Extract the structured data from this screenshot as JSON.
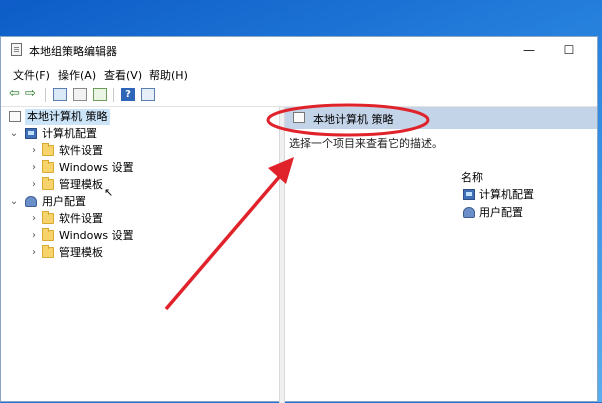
{
  "window": {
    "title": "本地组策略编辑器",
    "controls": {
      "minimize": "—",
      "maximize": "☐"
    }
  },
  "menu": [
    "文件(F)",
    "操作(A)",
    "查看(V)",
    "帮助(H)"
  ],
  "tree": {
    "root": "本地计算机 策略",
    "computer_config": "计算机配置",
    "computer_children": [
      "软件设置",
      "Windows 设置",
      "管理模板"
    ],
    "user_config": "用户配置",
    "user_children": [
      "软件设置",
      "Windows 设置",
      "管理模板"
    ]
  },
  "right": {
    "header": "本地计算机 策略",
    "description": "选择一个项目来查看它的描述。",
    "column_header": "名称",
    "items": [
      "计算机配置",
      "用户配置"
    ]
  },
  "annotation": {
    "color": "#e0232b"
  }
}
